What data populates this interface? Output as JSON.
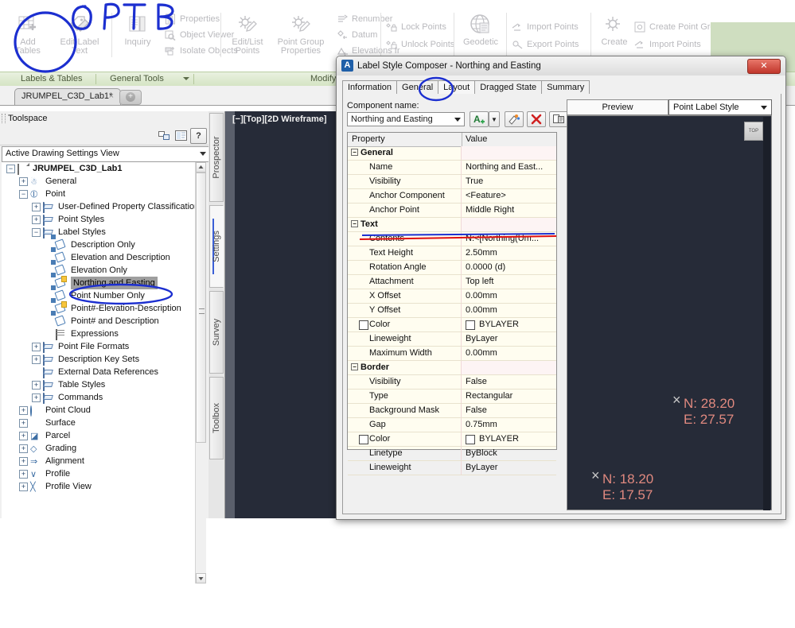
{
  "ribbon": {
    "groups": [
      {
        "name": "Labels & Tables",
        "big_buttons": [
          {
            "label_line1": "Add",
            "label_line2": "Tables",
            "icon": "table-add-icon"
          },
          {
            "label_line1": "Edit Label",
            "label_line2": "Text",
            "icon": "edit-label-text-icon"
          }
        ],
        "stack_items": []
      },
      {
        "name": "General Tools",
        "big_buttons": [
          {
            "label_line1": "Inquiry",
            "label_line2": "",
            "icon": "inquiry-icon"
          }
        ],
        "stack_items": [
          "Properties",
          "Object Viewer",
          "Isolate Objects"
        ]
      },
      {
        "name": "Modify",
        "big_buttons": [
          {
            "label_line1": "Edit/List",
            "label_line2": "Points",
            "icon": "edit-list-points-icon"
          },
          {
            "label_line1": "Point Group",
            "label_line2": "Properties",
            "icon": "point-group-properties-icon"
          }
        ],
        "stack_items": [
          "Renumber",
          "Datum",
          "Elevations fr"
        ]
      },
      {
        "name": "",
        "big_buttons": [],
        "stack_items": [
          "Lock Points",
          "Unlock Points"
        ]
      },
      {
        "name": "",
        "big_buttons": [
          {
            "label_line1": "Geodetic",
            "label_line2": "",
            "icon": "geodetic-icon"
          }
        ],
        "stack_items": []
      },
      {
        "name": "",
        "big_buttons": [],
        "stack_items": [
          "Import Points",
          "Export Points"
        ]
      },
      {
        "name": "",
        "big_buttons": [
          {
            "label_line1": "Create",
            "label_line2": "",
            "icon": "create-icon"
          }
        ],
        "stack_items": [
          "Create Point Group",
          "Import Points"
        ]
      }
    ],
    "panel_labels": [
      "Labels & Tables",
      "General Tools",
      "Modify"
    ]
  },
  "handwriting": {
    "note": "OPT B"
  },
  "file_tab": {
    "label": "JRUMPEL_C3D_Lab1*",
    "close_glyph": "×",
    "new_tab_glyph": "+"
  },
  "toolspace": {
    "title": "Toolspace",
    "toolbar_icons": [
      "panel-layout-icon",
      "properties-icon",
      "help-icon"
    ],
    "help_glyph": "?",
    "view_selector": "Active Drawing Settings View",
    "vertical_tabs": [
      "Prospector",
      "Settings",
      "Survey",
      "Toolbox"
    ],
    "active_vertical_tab": "Settings",
    "tree": [
      {
        "label": "JRUMPEL_C3D_Lab1",
        "depth": 0,
        "expander": "-",
        "icon": "drawing-icon",
        "bold": true,
        "selected": false,
        "flag": false
      },
      {
        "label": "General",
        "depth": 1,
        "expander": "+",
        "icon": "general-icon",
        "bold": false,
        "selected": false,
        "flag": false
      },
      {
        "label": "Point",
        "depth": 1,
        "expander": "-",
        "icon": "point-icon",
        "bold": false,
        "selected": false,
        "flag": false
      },
      {
        "label": "User-Defined Property Classifications",
        "depth": 2,
        "expander": "+",
        "icon": "folder-icon",
        "bold": false,
        "selected": false,
        "flag": false
      },
      {
        "label": "Point Styles",
        "depth": 2,
        "expander": "+",
        "icon": "folder-icon",
        "bold": false,
        "selected": false,
        "flag": false
      },
      {
        "label": "Label Styles",
        "depth": 2,
        "expander": "-",
        "icon": "folder-icon",
        "bold": false,
        "selected": false,
        "flag": false
      },
      {
        "label": "Description Only",
        "depth": 3,
        "expander": "",
        "icon": "label-style-icon",
        "bold": false,
        "selected": false,
        "flag": false
      },
      {
        "label": "Elevation and Description",
        "depth": 3,
        "expander": "",
        "icon": "label-style-icon",
        "bold": false,
        "selected": false,
        "flag": false
      },
      {
        "label": "Elevation Only",
        "depth": 3,
        "expander": "",
        "icon": "label-style-icon",
        "bold": false,
        "selected": false,
        "flag": false
      },
      {
        "label": "Northing and Easting",
        "depth": 3,
        "expander": "",
        "icon": "label-style-icon",
        "bold": false,
        "selected": true,
        "flag": true
      },
      {
        "label": "Point Number Only",
        "depth": 3,
        "expander": "",
        "icon": "label-style-icon",
        "bold": false,
        "selected": false,
        "flag": false
      },
      {
        "label": "Point#-Elevation-Description",
        "depth": 3,
        "expander": "",
        "icon": "label-style-icon",
        "bold": false,
        "selected": false,
        "flag": true
      },
      {
        "label": "Point# and Description",
        "depth": 3,
        "expander": "",
        "icon": "label-style-icon",
        "bold": false,
        "selected": false,
        "flag": false
      },
      {
        "label": "Expressions",
        "depth": 3,
        "expander": "",
        "icon": "expressions-icon",
        "bold": false,
        "selected": false,
        "flag": false
      },
      {
        "label": "Point File Formats",
        "depth": 2,
        "expander": "+",
        "icon": "folder-icon",
        "bold": false,
        "selected": false,
        "flag": false
      },
      {
        "label": "Description Key Sets",
        "depth": 2,
        "expander": "+",
        "icon": "folder-icon",
        "bold": false,
        "selected": false,
        "flag": false
      },
      {
        "label": "External Data References",
        "depth": 2,
        "expander": "",
        "icon": "folder-icon",
        "bold": false,
        "selected": false,
        "flag": false
      },
      {
        "label": "Table Styles",
        "depth": 2,
        "expander": "+",
        "icon": "folder-icon",
        "bold": false,
        "selected": false,
        "flag": false
      },
      {
        "label": "Commands",
        "depth": 2,
        "expander": "+",
        "icon": "folder-icon",
        "bold": false,
        "selected": false,
        "flag": false
      },
      {
        "label": "Point Cloud",
        "depth": 1,
        "expander": "+",
        "icon": "point-cloud-icon",
        "bold": false,
        "selected": false,
        "flag": false
      },
      {
        "label": "Surface",
        "depth": 1,
        "expander": "+",
        "icon": "surface-icon",
        "bold": false,
        "selected": false,
        "flag": false
      },
      {
        "label": "Parcel",
        "depth": 1,
        "expander": "+",
        "icon": "parcel-icon",
        "bold": false,
        "selected": false,
        "flag": false
      },
      {
        "label": "Grading",
        "depth": 1,
        "expander": "+",
        "icon": "grading-icon",
        "bold": false,
        "selected": false,
        "flag": false
      },
      {
        "label": "Alignment",
        "depth": 1,
        "expander": "+",
        "icon": "alignment-icon",
        "bold": false,
        "selected": false,
        "flag": false
      },
      {
        "label": "Profile",
        "depth": 1,
        "expander": "+",
        "icon": "profile-icon",
        "bold": false,
        "selected": false,
        "flag": false
      },
      {
        "label": "Profile View",
        "depth": 1,
        "expander": "+",
        "icon": "profile-view-icon",
        "bold": false,
        "selected": false,
        "flag": false
      }
    ]
  },
  "drawing": {
    "viewport_label": "[−][Top][2D Wireframe]"
  },
  "dialog": {
    "title": "Label Style Composer - Northing and Easting",
    "app_icon_glyph": "A",
    "close_glyph": "✕",
    "tabs": [
      "Information",
      "General",
      "Layout",
      "Dragged State",
      "Summary"
    ],
    "active_tab": "Layout",
    "component_label": "Component name:",
    "component_value": "Northing and Easting",
    "component_buttons": [
      {
        "name": "create-text-component-button",
        "glyph": "A"
      },
      {
        "name": "create-text-dropdown-button",
        "glyph": "▾"
      },
      {
        "name": "copy-component-button",
        "glyph": "❖"
      },
      {
        "name": "delete-component-button",
        "glyph": "✕"
      },
      {
        "name": "component-draw-order-button",
        "glyph": "❐"
      }
    ],
    "grid": {
      "headers": [
        "Property",
        "Value"
      ],
      "rows": [
        {
          "type": "category",
          "name": "General",
          "value": "",
          "expander": "-"
        },
        {
          "type": "item",
          "name": "Name",
          "value": "Northing and East..."
        },
        {
          "type": "item",
          "name": "Visibility",
          "value": "True"
        },
        {
          "type": "item",
          "name": "Anchor Component",
          "value": "<Feature>"
        },
        {
          "type": "item",
          "name": "Anchor Point",
          "value": "Middle Right"
        },
        {
          "type": "category",
          "name": "Text",
          "value": "",
          "expander": "-"
        },
        {
          "type": "item",
          "name": "Contents",
          "value": "N:<[Northing(Um...",
          "underlined": true
        },
        {
          "type": "item",
          "name": "Text Height",
          "value": "2.50mm"
        },
        {
          "type": "item",
          "name": "Rotation Angle",
          "value": "0.0000 (d)"
        },
        {
          "type": "item",
          "name": "Attachment",
          "value": "Top left"
        },
        {
          "type": "item",
          "name": "X Offset",
          "value": "0.00mm"
        },
        {
          "type": "item",
          "name": "Y Offset",
          "value": "0.00mm"
        },
        {
          "type": "color",
          "name": "Color",
          "value": "BYLAYER"
        },
        {
          "type": "item",
          "name": "Lineweight",
          "value": "ByLayer"
        },
        {
          "type": "item",
          "name": "Maximum Width",
          "value": "0.00mm"
        },
        {
          "type": "category",
          "name": "Border",
          "value": "",
          "expander": "-"
        },
        {
          "type": "item",
          "name": "Visibility",
          "value": "False"
        },
        {
          "type": "item",
          "name": "Type",
          "value": "Rectangular"
        },
        {
          "type": "item",
          "name": "Background Mask",
          "value": "False"
        },
        {
          "type": "item",
          "name": "Gap",
          "value": "0.75mm"
        },
        {
          "type": "color",
          "name": "Color",
          "value": "BYLAYER"
        },
        {
          "type": "item",
          "name": "Linetype",
          "value": "ByBlock"
        },
        {
          "type": "item",
          "name": "Lineweight",
          "value": "ByLayer"
        }
      ]
    },
    "preview": {
      "tab_label": "Preview",
      "style_selector": "Point Label Style",
      "view_cube_label": "TOP",
      "labels": [
        {
          "north": "N: 28.20",
          "east": "E: 27.57",
          "marker": "×"
        },
        {
          "north": "N: 18.20",
          "east": "E: 17.57",
          "marker": "×"
        }
      ],
      "text_color": "#e0897f",
      "background_color": "#262b38"
    }
  }
}
